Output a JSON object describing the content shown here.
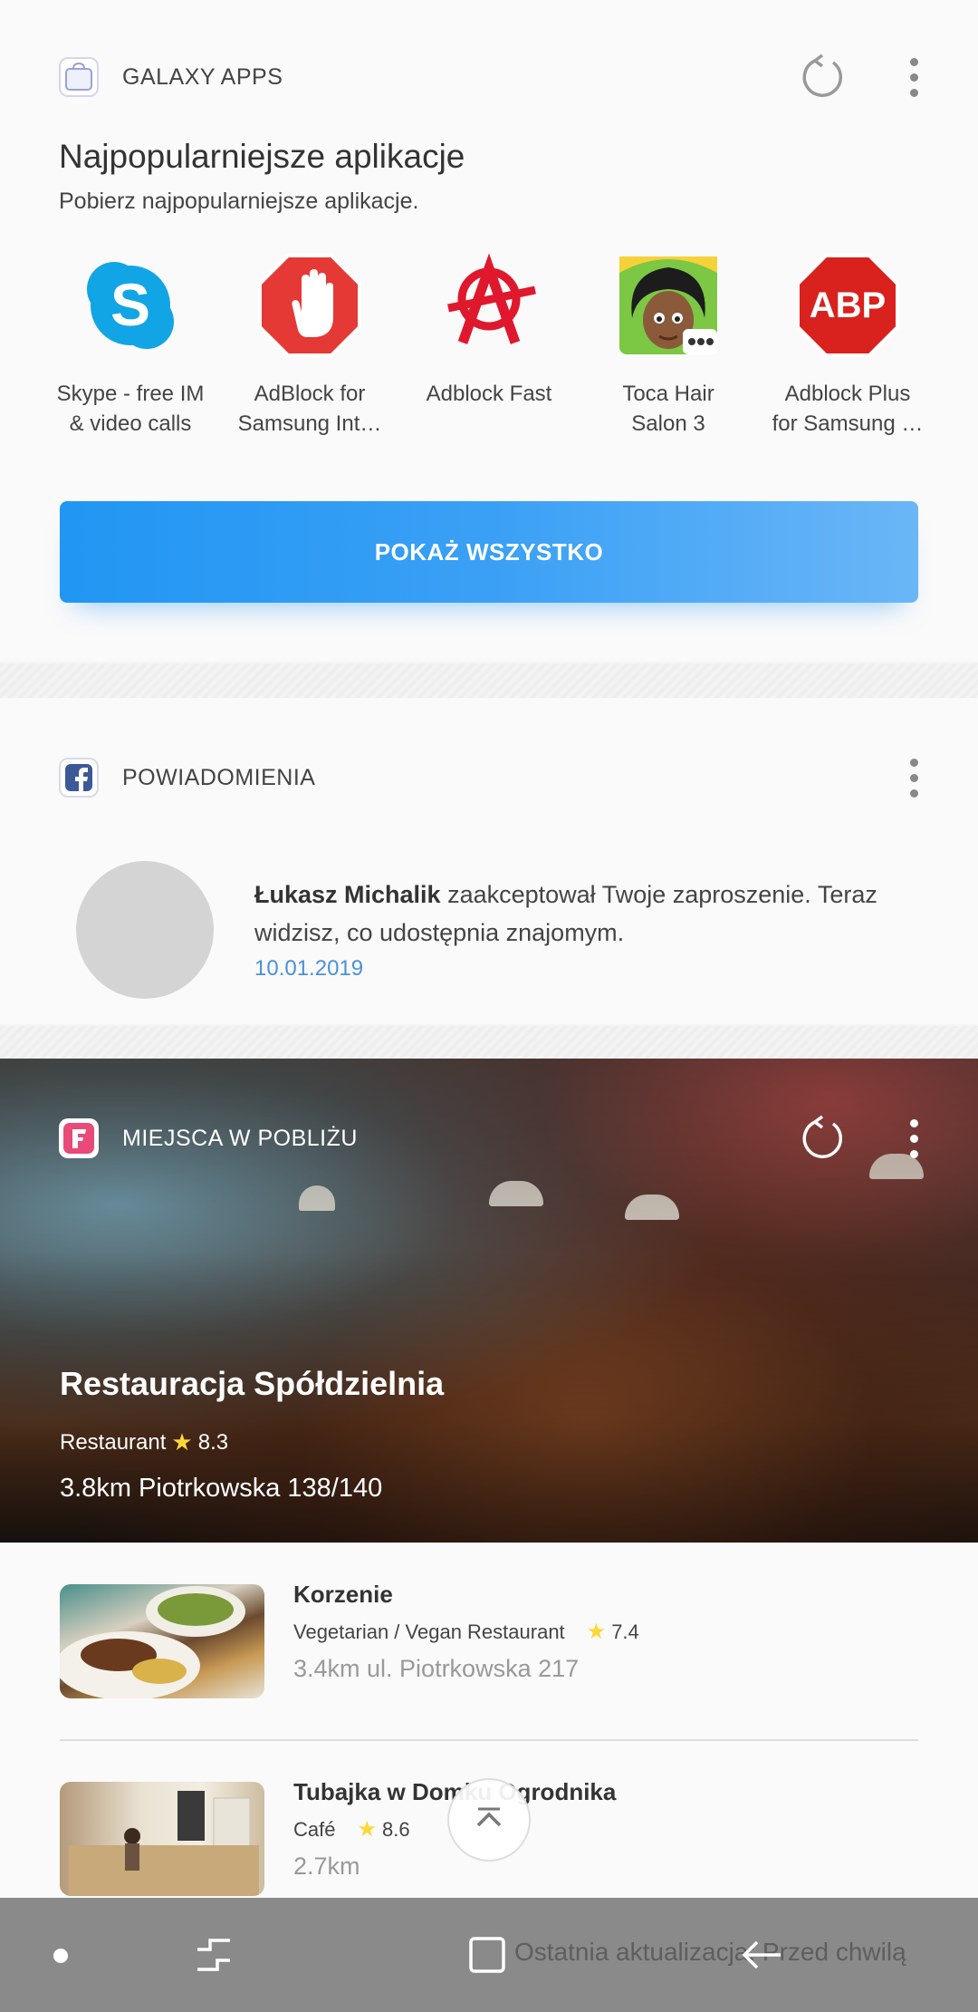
{
  "galaxy_apps": {
    "header_title": "GALAXY APPS",
    "title": "Najpopularniejsze aplikacje",
    "subtitle": "Pobierz najpopularniejsze aplikacje.",
    "apps": [
      {
        "name": "Skype - free IM\n& video calls",
        "icon": "skype-icon"
      },
      {
        "name": "AdBlock for\nSamsung Int…",
        "icon": "adblock-hand-icon"
      },
      {
        "name": "Adblock Fast",
        "icon": "adblock-fast-icon"
      },
      {
        "name": "Toca Hair\nSalon 3",
        "icon": "toca-hair-icon"
      },
      {
        "name": "Adblock Plus\nfor Samsung …",
        "icon": "abp-icon"
      }
    ],
    "abp_label": "ABP",
    "show_all": "POKAŻ WSZYSTKO"
  },
  "notifications": {
    "header_title": "POWIADOMIENIA",
    "author": "Łukasz Michalik",
    "message": " zaakceptował Twoje zaproszenie. Teraz widzisz, co udostępnia znajomym.",
    "date": "10.01.2019"
  },
  "places": {
    "header_title": "MIEJSCA W POBLIŻU",
    "featured": {
      "name": "Restauracja Spółdzielnia",
      "category": "Restaurant",
      "rating": "8.3",
      "address": "3.8km Piotrkowska 138/140"
    },
    "items": [
      {
        "name": "Korzenie",
        "category": "Vegetarian / Vegan Restaurant",
        "rating": "7.4",
        "address": "3.4km ul. Piotrkowska 217"
      },
      {
        "name": "Tubajka w Domku Ogrodnika",
        "category": "Café",
        "rating": "8.6",
        "address": "2.7km"
      }
    ]
  },
  "footer": {
    "last_update": "Ostatnia aktualizacja: Przed chwilą"
  },
  "colors": {
    "accent": "#2196f3",
    "date_link": "#4a90d9",
    "star": "#fdd835",
    "navbar": "#8a8a8a"
  }
}
